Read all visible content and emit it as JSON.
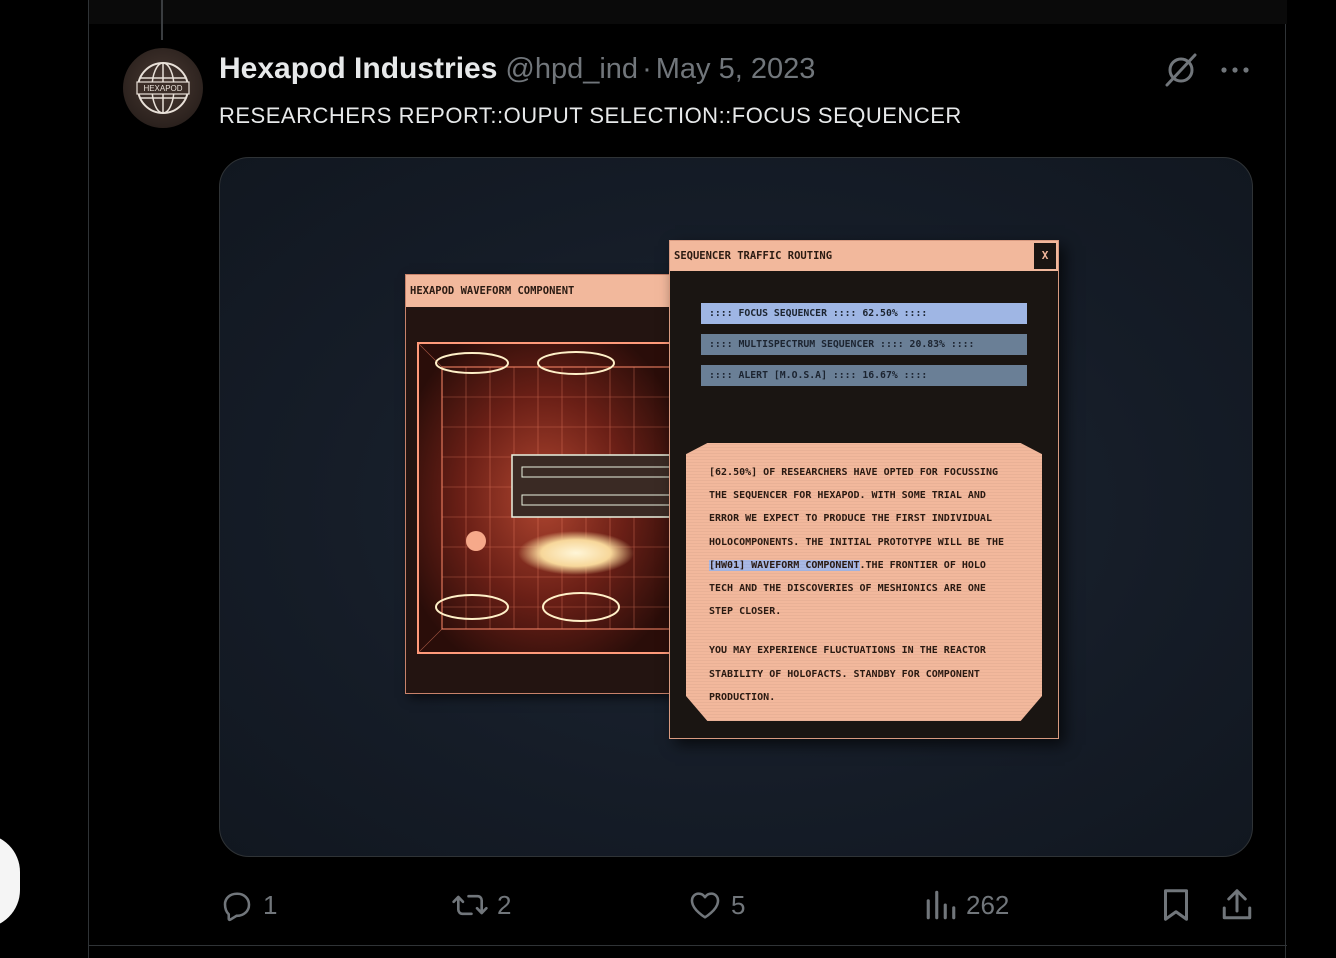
{
  "tweet": {
    "display_name": "Hexapod Industries",
    "handle": "@hpd_ind",
    "separator": "·",
    "date": "May 5, 2023",
    "text": "RESEARCHERS REPORT::OUPUT SELECTION::FOCUS SEQUENCER",
    "avatar_text": "HEXAPOD",
    "icons": {
      "grok": "grok-icon",
      "more": "more-icon"
    }
  },
  "media": {
    "waveform_window": {
      "title": "HEXAPOD WAVEFORM COMPONENT"
    },
    "sequencer_window": {
      "title": "SEQUENCER TRAFFIC ROUTING",
      "close_label": "X",
      "bars": [
        {
          "label": ":::: FOCUS SEQUENCER :::: 62.50% ::::",
          "selected": true
        },
        {
          "label": ":::: MULTISPECTRUM SEQUENCER :::: 20.83% ::::",
          "selected": false
        },
        {
          "label": ":::: ALERT [M.O.S.A] :::: 16.67% ::::",
          "selected": false
        }
      ],
      "report": {
        "line1": "[62.50%] OF RESEARCHERS HAVE OPTED FOR FOCUSSING",
        "line2": "THE SEQUENCER FOR HEXAPOD. WITH SOME TRIAL AND",
        "line3": "ERROR WE EXPECT TO PRODUCE THE FIRST INDIVIDUAL",
        "line4": "HOLOCOMPONENTS. THE INITIAL PROTOTYPE WILL BE THE",
        "line5_highlight": "[HW01] WAVEFORM COMPONENT",
        "line5_rest": ".THE FRONTIER OF HOLO",
        "line6": "TECH AND THE DISCOVERIES OF MESHIONICS ARE ONE",
        "line7": "STEP CLOSER.",
        "line8": "YOU MAY EXPERIENCE FLUCTUATIONS IN THE REACTOR",
        "line9": "STABILITY OF HOLOFACTS. STANDBY FOR COMPONENT",
        "line10": "PRODUCTION."
      }
    }
  },
  "actions": {
    "reply_count": "1",
    "retweet_count": "2",
    "like_count": "5",
    "views_count": "262"
  },
  "colors": {
    "background": "#000000",
    "muted_text": "#71767b",
    "primary_text": "#e7e9ea",
    "window_peach": "#f2b89c",
    "bar_selected": "#9fb6e4",
    "bar_default": "#6a7f96"
  }
}
